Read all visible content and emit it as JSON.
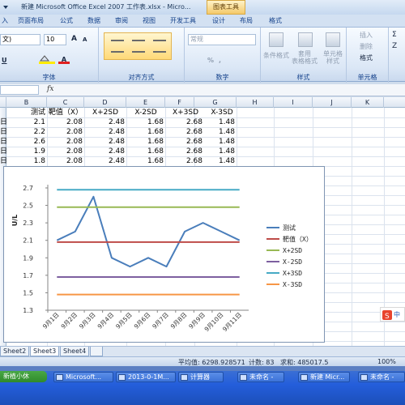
{
  "window": {
    "title": "新建 Microsoft Office Excel 2007 工作表.xlsx - Micro...",
    "context_tab": "图表工具"
  },
  "ribbon_tabs": [
    "入",
    "页面布局",
    "公式",
    "数据",
    "审阅",
    "视图",
    "开发工具",
    "设计",
    "布局",
    "格式"
  ],
  "ribbon": {
    "font_name": "文)",
    "font_size": "10",
    "grow_font": "A",
    "shrink_font": "A",
    "underline": "U",
    "number_format": "常规",
    "percent": "%",
    "comma": ",",
    "cond_format": "条件格式",
    "table_format": "套用\n表格格式",
    "cell_style": "单元格\n样式",
    "insert": "插入",
    "delete": "删除",
    "format": "格式",
    "sum": "Σ",
    "sort": "Z",
    "groups": {
      "font": "字体",
      "alignment": "对齐方式",
      "number": "数字",
      "styles": "样式",
      "cells": "单元格"
    }
  },
  "formula_bar": {
    "fx": "fx"
  },
  "columns": [
    "B",
    "C",
    "D",
    "E",
    "F",
    "G",
    "H",
    "I",
    "J",
    "K"
  ],
  "sheet": {
    "headers": [
      "测试",
      "靶值（X）",
      "X+2SD",
      "X-2SD",
      "X+3SD",
      "X-3SD"
    ],
    "rows": [
      {
        "a": "日",
        "b": "2.1",
        "c": "2.08",
        "d": "2.48",
        "e": "1.68",
        "f": "2.68",
        "g": "1.48"
      },
      {
        "a": "日",
        "b": "2.2",
        "c": "2.08",
        "d": "2.48",
        "e": "1.68",
        "f": "2.68",
        "g": "1.48"
      },
      {
        "a": "日",
        "b": "2.6",
        "c": "2.08",
        "d": "2.48",
        "e": "1.68",
        "f": "2.68",
        "g": "1.48"
      },
      {
        "a": "日",
        "b": "1.9",
        "c": "2.08",
        "d": "2.48",
        "e": "1.68",
        "f": "2.68",
        "g": "1.48"
      },
      {
        "a": "日",
        "b": "1.8",
        "c": "2.08",
        "d": "2.48",
        "e": "1.68",
        "f": "2.68",
        "g": "1.48"
      }
    ]
  },
  "chart_data": {
    "type": "line",
    "ylabel": "U/L",
    "ylim": [
      1.3,
      2.7
    ],
    "yticks": [
      "2.7",
      "2.5",
      "2.3",
      "2.1",
      "1.9",
      "1.7",
      "1.5",
      "1.3"
    ],
    "categories": [
      "9月1日",
      "9月2日",
      "9月3日",
      "9月4日",
      "9月5日",
      "9月6日",
      "9月7日",
      "9月8日",
      "9月9日",
      "9月10日",
      "9月11日"
    ],
    "legend_position": "right",
    "series": [
      {
        "name": "测试",
        "color": "#4a7ebb",
        "values": [
          2.1,
          2.2,
          2.6,
          1.9,
          1.8,
          1.9,
          1.8,
          2.2,
          2.3,
          2.2,
          2.1
        ]
      },
      {
        "name": "靶值（X）",
        "color": "#be4b48",
        "values": [
          2.08,
          2.08,
          2.08,
          2.08,
          2.08,
          2.08,
          2.08,
          2.08,
          2.08,
          2.08,
          2.08
        ]
      },
      {
        "name": "X+2SD",
        "color": "#98b954",
        "values": [
          2.48,
          2.48,
          2.48,
          2.48,
          2.48,
          2.48,
          2.48,
          2.48,
          2.48,
          2.48,
          2.48
        ]
      },
      {
        "name": "X-2SD",
        "color": "#7d60a0",
        "values": [
          1.68,
          1.68,
          1.68,
          1.68,
          1.68,
          1.68,
          1.68,
          1.68,
          1.68,
          1.68,
          1.68
        ]
      },
      {
        "name": "X+3SD",
        "color": "#46aac5",
        "values": [
          2.68,
          2.68,
          2.68,
          2.68,
          2.68,
          2.68,
          2.68,
          2.68,
          2.68,
          2.68,
          2.68
        ]
      },
      {
        "name": "X-3SD",
        "color": "#f79646",
        "values": [
          1.48,
          1.48,
          1.48,
          1.48,
          1.48,
          1.48,
          1.48,
          1.48,
          1.48,
          1.48,
          1.48
        ]
      }
    ]
  },
  "sheet_tabs": [
    "Sheet2",
    "Sheet3",
    "Sheet4"
  ],
  "status": {
    "average": "平均值: 6298.928571",
    "count": "计数: 83",
    "sum": "求和: 485017.5",
    "zoom": "100%"
  },
  "ime_label": "中",
  "taskbar": {
    "start": "新植小休",
    "items": [
      "Microsoft...",
      "2013-0-1M...",
      "计算器",
      "未命名 -",
      "新建 Micr...",
      "未命名 -"
    ]
  }
}
